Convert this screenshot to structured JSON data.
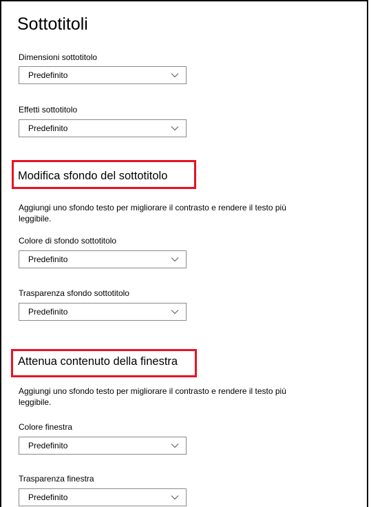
{
  "page": {
    "title": "Sottotitoli"
  },
  "subtitle_size": {
    "label": "Dimensioni sottotitolo",
    "value": "Predefinito"
  },
  "subtitle_effects": {
    "label": "Effetti sottotitolo",
    "value": "Predefinito"
  },
  "background_section": {
    "title": "Modifica sfondo del sottotitolo",
    "description": "Aggiungi uno sfondo testo per migliorare il contrasto e rendere il testo più leggibile.",
    "color": {
      "label": "Colore di sfondo sottotitolo",
      "value": "Predefinito"
    },
    "transparency": {
      "label": "Trasparenza sfondo sottotitolo",
      "value": "Predefinito"
    }
  },
  "window_section": {
    "title": "Attenua contenuto della finestra",
    "description": "Aggiungi uno sfondo testo per migliorare il contrasto e rendere il testo più leggibile.",
    "color": {
      "label": "Colore finestra",
      "value": "Predefinito"
    },
    "transparency": {
      "label": "Trasparenza finestra",
      "value": "Predefinito"
    }
  },
  "colors": {
    "highlight_border": "#e81123",
    "dropdown_border": "#8a8a8a"
  },
  "icons": {
    "dropdown": "chevron-down-icon"
  }
}
